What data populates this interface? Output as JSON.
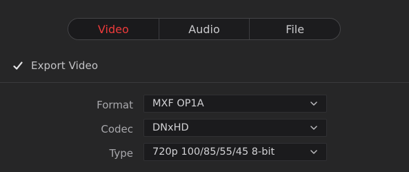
{
  "tabs": [
    {
      "label": "Video",
      "active": true
    },
    {
      "label": "Audio",
      "active": false
    },
    {
      "label": "File",
      "active": false
    }
  ],
  "export_video": {
    "label": "Export Video",
    "checked": true
  },
  "fields": {
    "format": {
      "label": "Format",
      "value": "MXF OP1A"
    },
    "codec": {
      "label": "Codec",
      "value": "DNxHD"
    },
    "type": {
      "label": "Type",
      "value": "720p 100/85/55/45 8-bit"
    }
  },
  "colors": {
    "accent_active_tab": "#ee3b3b",
    "background": "#262627",
    "field_background": "#1b1b1d"
  },
  "icons": {
    "checkbox": "check-icon",
    "dropdown": "chevron-down-icon"
  }
}
